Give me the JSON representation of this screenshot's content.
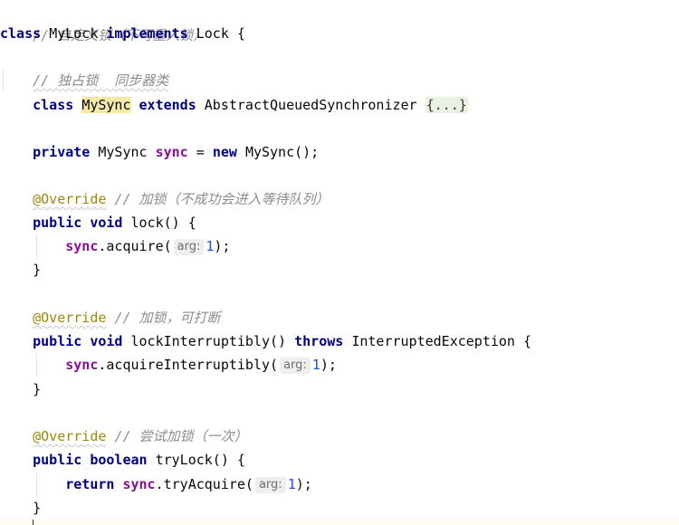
{
  "code": {
    "line1_comment": "// 自定义锁（不可重入锁）",
    "line2": {
      "kw_class": "class",
      "name": "MyLock",
      "kw_implements": "implements",
      "iface": "Lock",
      "brace": "{"
    },
    "line4_comment": "// 独占锁  同步器类",
    "line5": {
      "kw_class": "class",
      "name": "MySync",
      "kw_extends": "extends",
      "base": "AbstractQueuedSynchronizer",
      "folded": "{...}"
    },
    "line7": {
      "kw_private": "private",
      "type": "MySync",
      "field": "sync",
      "eq": "=",
      "kw_new": "new",
      "ctor": "MySync();"
    },
    "line9": {
      "ann": "@Override",
      "comment": "// 加锁（不成功会进入等待队列）"
    },
    "line10": {
      "kw_public": "public",
      "kw_void": "void",
      "sig": "lock() {"
    },
    "line11": {
      "field": "sync",
      "call": ".acquire(",
      "hint": "arg:",
      "num": "1",
      "end": ");"
    },
    "line12": "}",
    "line14": {
      "ann": "@Override",
      "comment": "// 加锁，可打断"
    },
    "line15": {
      "kw_public": "public",
      "kw_void": "void",
      "sig": "lockInterruptibly()",
      "kw_throws": "throws",
      "exc": "InterruptedException {"
    },
    "line16": {
      "field": "sync",
      "call": ".acquireInterruptibly(",
      "hint": "arg:",
      "num": "1",
      "end": ");"
    },
    "line17": "}",
    "line19": {
      "ann": "@Override",
      "comment": "// 尝试加锁（一次）"
    },
    "line20": {
      "kw_public": "public",
      "kw_boolean": "boolean",
      "sig": "tryLock() {"
    },
    "line21": {
      "kw_return": "return",
      "field": "sync",
      "call": ".tryAcquire(",
      "hint": "arg:",
      "num": "1",
      "end": ");"
    },
    "line22": "}"
  },
  "colors": {
    "keyword": "#0033b3",
    "field": "#871094",
    "annotation": "#9e880d",
    "comment": "#8c8c8c",
    "number": "#1750eb",
    "class_highlight": "#f5eaa8",
    "folded_bg": "#e8f2e2"
  }
}
